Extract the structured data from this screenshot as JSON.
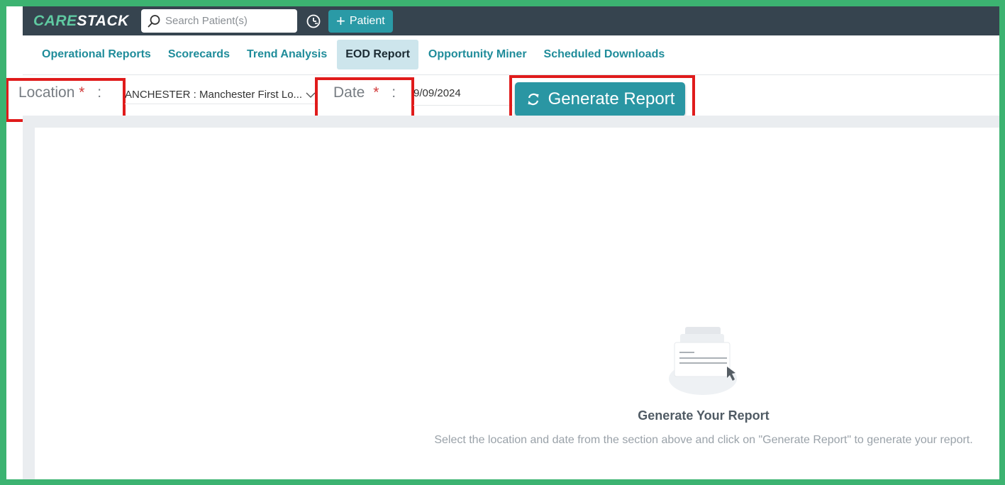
{
  "app": {
    "logo_left": "CARE",
    "logo_right": "STACK"
  },
  "search": {
    "placeholder": "Search Patient(s)"
  },
  "header": {
    "patient_button_label": "Patient",
    "accent_color": "#2a9aa6",
    "bar_color": "#36444f"
  },
  "tabs": [
    {
      "label": "Operational Reports",
      "active": false
    },
    {
      "label": "Scorecards",
      "active": false
    },
    {
      "label": "Trend Analysis",
      "active": false
    },
    {
      "label": "EOD Report",
      "active": true
    },
    {
      "label": "Opportunity Miner",
      "active": false
    },
    {
      "label": "Scheduled Downloads",
      "active": false
    }
  ],
  "filters": {
    "location_label": "Location",
    "location_required": "*",
    "location_colon": ":",
    "location_value": "ANCHESTER : Manchester First Lo...",
    "date_label": "Date",
    "date_required": "*",
    "date_colon": ":",
    "date_value": "9/09/2024",
    "generate_button_label": "Generate Report",
    "highlight_color": "#e01b1b"
  },
  "empty_state": {
    "title": "Generate Your Report",
    "description": "Select the location and date from the section above and click on \"Generate Report\" to generate your report."
  }
}
